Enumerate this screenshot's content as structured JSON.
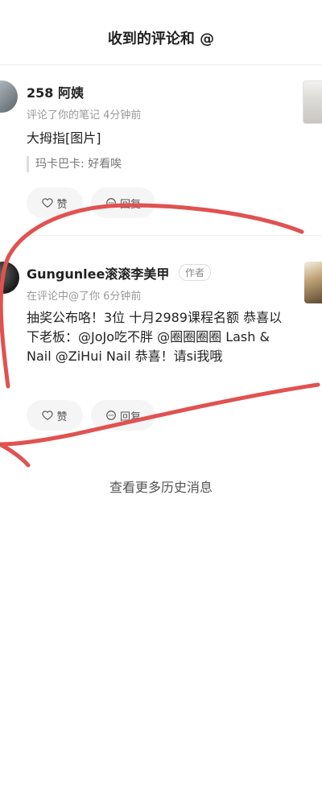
{
  "header": {
    "title": "收到的评论和 @"
  },
  "comments": [
    {
      "name": "258 阿姨",
      "meta": "评论了你的笔记  4分钟前",
      "content": "大拇指[图片]",
      "quote": "玛卡巴卡: 好看唉",
      "like_label": "赞",
      "reply_label": "回复"
    },
    {
      "name": "Gungunlee滚滚李美甲",
      "author_tag": "作者",
      "meta": "在评论中@了你  6分钟前",
      "content": "抽奖公布咯！3位 十月2989课程名额 恭喜以下老板：@JoJo吃不胖 @圈圈圈圈 Lash & Nail @ZiHui Nail  恭喜！请si我哦",
      "like_label": "赞",
      "reply_label": "回复"
    }
  ],
  "footer": {
    "more_label": "查看更多历史消息"
  },
  "colors": {
    "annotation_stroke": "#e05250"
  }
}
